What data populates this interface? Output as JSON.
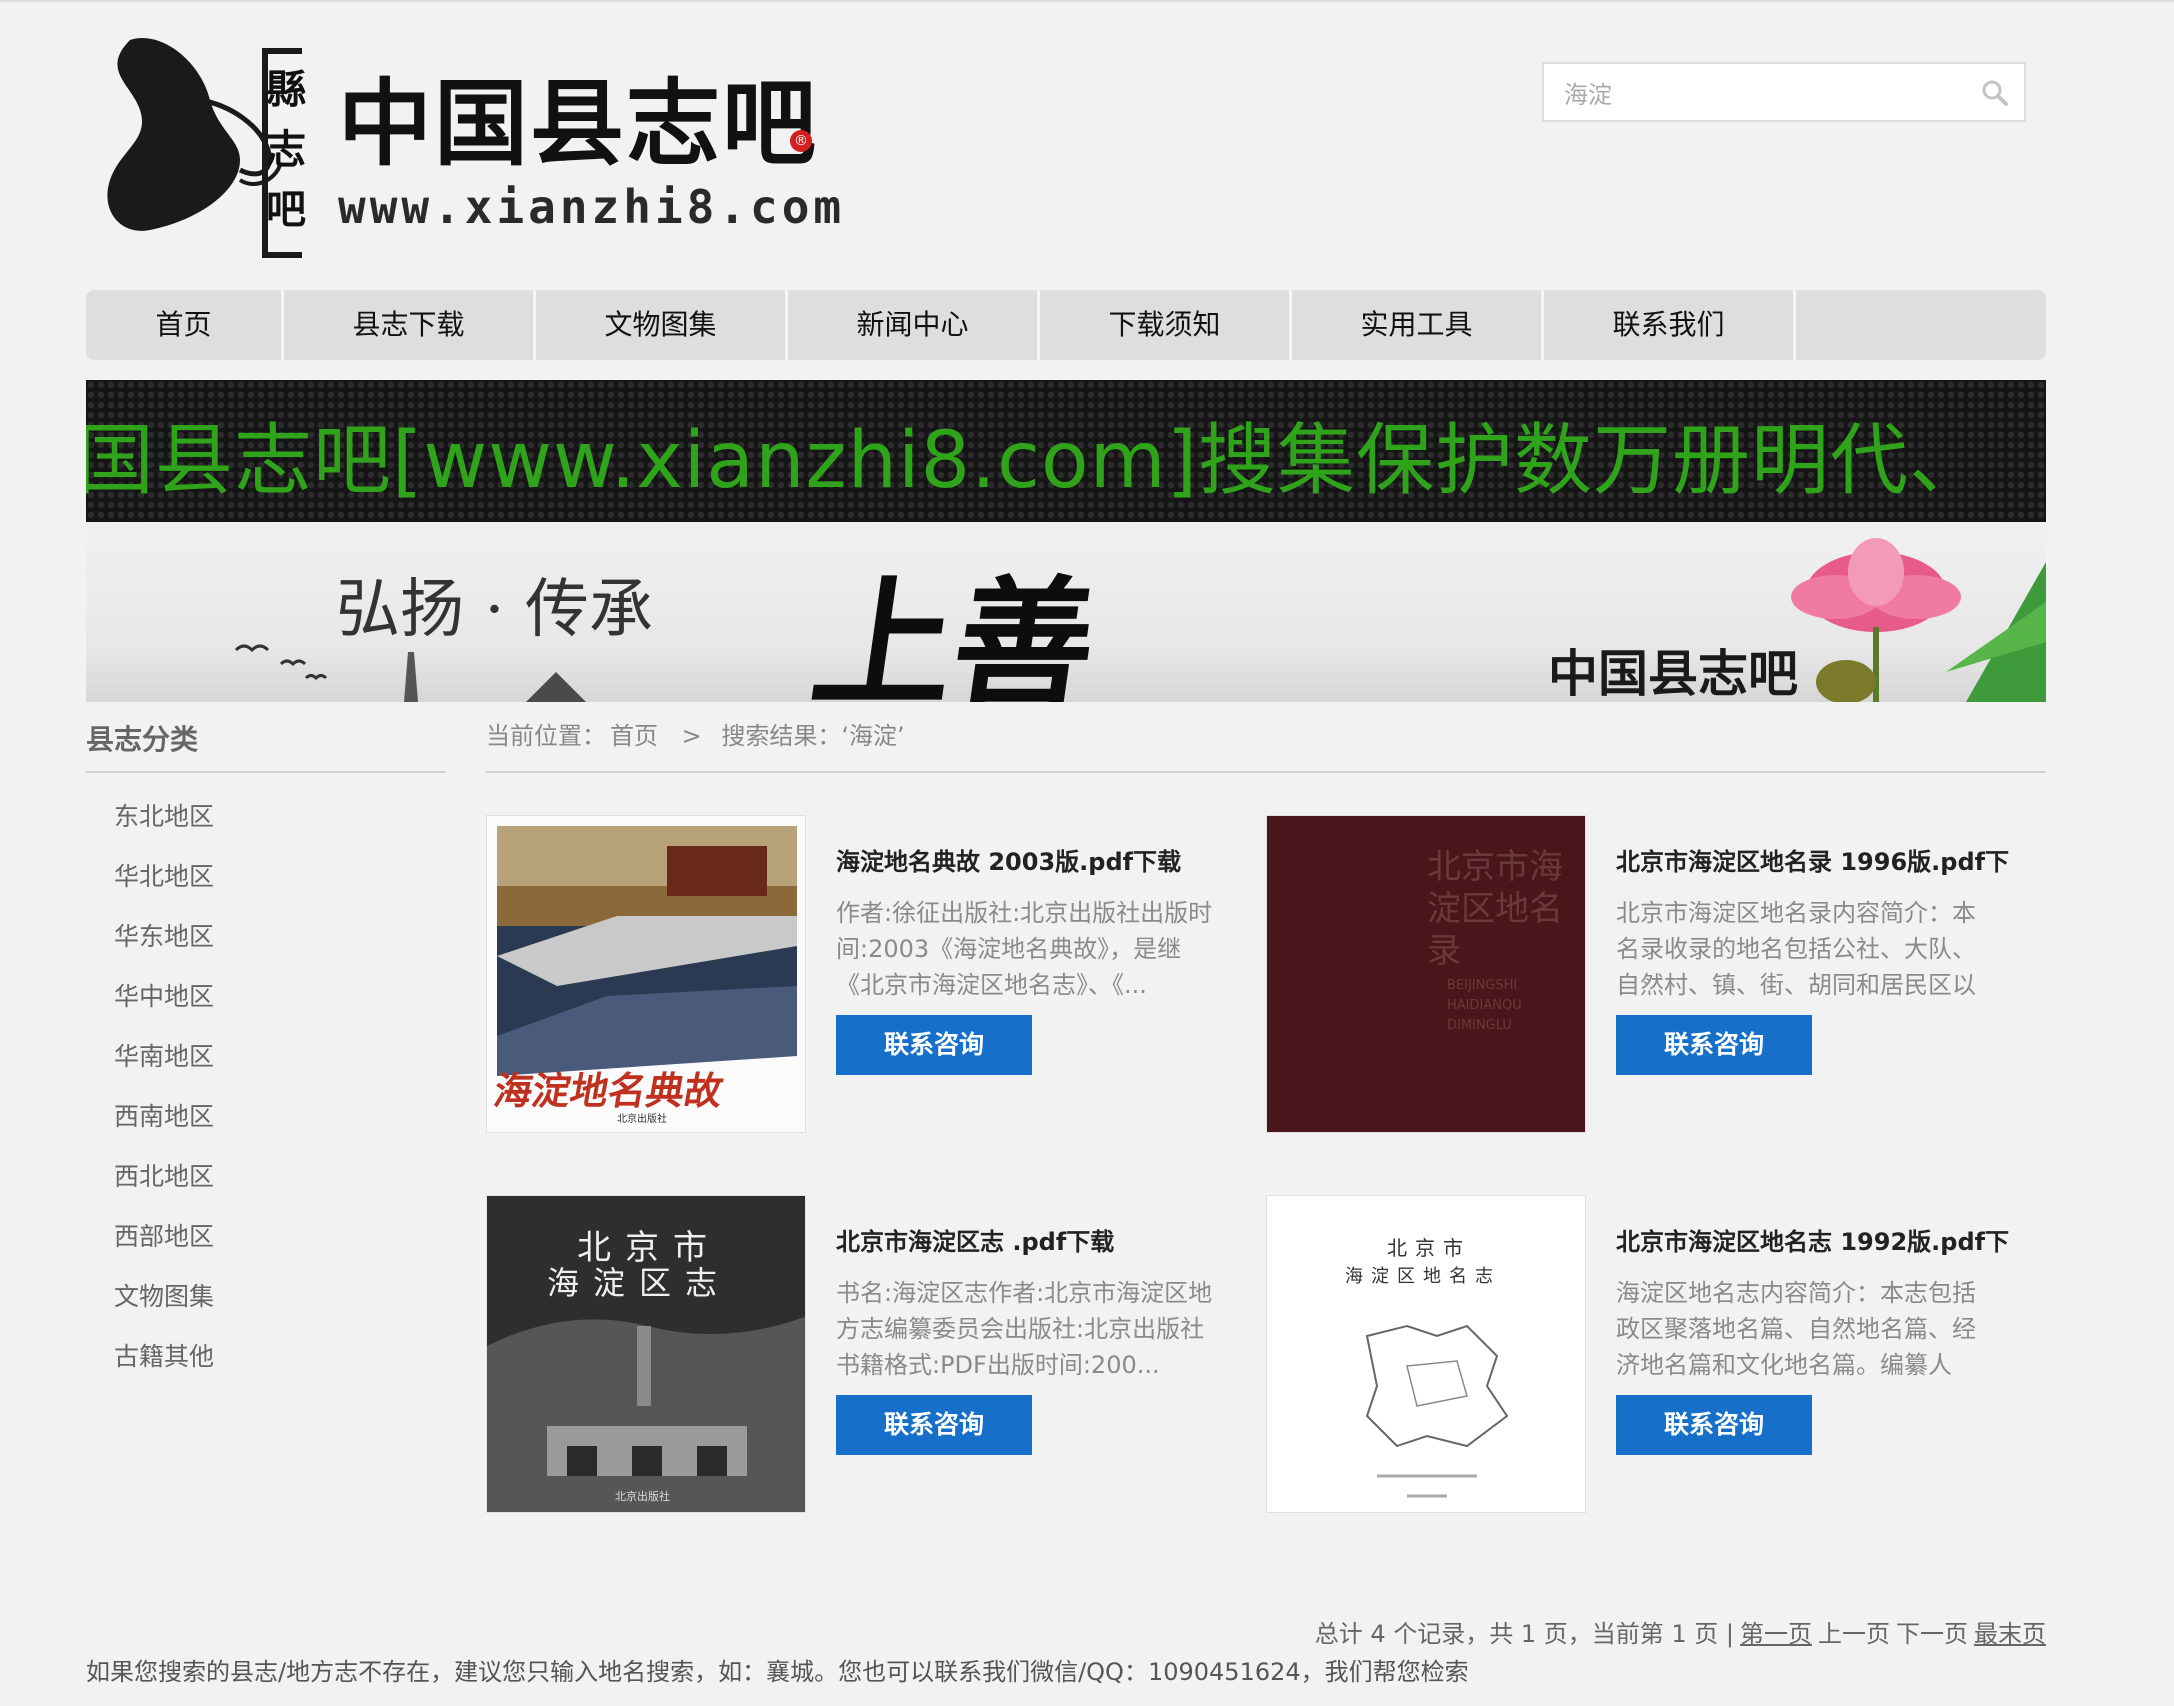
{
  "header": {
    "logo_vertical": "縣志吧",
    "logo_title": "中国县志吧",
    "logo_reg_mark": "®",
    "logo_url": "www.xianzhi8.com",
    "search": {
      "value": "海淀"
    }
  },
  "nav": {
    "items": [
      "首页",
      "县志下载",
      "文物图集",
      "新闻中心",
      "下载须知",
      "实用工具",
      "联系我们"
    ]
  },
  "marquee": {
    "text": "国县志吧[www.xianzhi8.com]搜集保护数万册明代、"
  },
  "banner": {
    "slogan": "弘扬 · 传承",
    "big_text": "上善",
    "brand": "中国县志吧"
  },
  "sidebar": {
    "title": "县志分类",
    "items": [
      "东北地区",
      "华北地区",
      "华东地区",
      "华中地区",
      "华南地区",
      "西南地区",
      "西北地区",
      "西部地区",
      "文物图集",
      "古籍其他"
    ]
  },
  "breadcrumb": {
    "label": "当前位置：",
    "home": "首页",
    "separator": ">",
    "current": "搜索结果：‘海淀’"
  },
  "results": [
    {
      "title": "海淀地名典故 2003版.pdf下载",
      "desc": "作者:徐征出版社:北京出版社出版时间:2003《海淀地名典故》，是继《北京市海淀区地名志》、《...",
      "button": "联系咨询",
      "cover_text": "海淀地名典故",
      "cover_publisher": "北京出版社"
    },
    {
      "title": "北京市海淀区地名录 1996版.pdf下",
      "desc": "北京市海淀区地名录内容简介：本名录收录的地名包括公社、大队、自然村、镇、街、胡同和居民区以及自...",
      "button": "联系咨询",
      "cover_text": "北京市海淀区地名录",
      "cover_pinyin": "BEIJINGSHI HAIDIANQU DIMINGLU"
    },
    {
      "title": "北京市海淀区志 .pdf下载",
      "desc": "书名:海淀区志作者:北京市海淀区地方志编纂委员会出版社:北京出版社书籍格式:PDF出版时间:200...",
      "button": "联系咨询",
      "cover_line1": "北京市",
      "cover_line2": "海淀区志",
      "cover_publisher": "北京出版社"
    },
    {
      "title": "北京市海淀区地名志 1992版.pdf下",
      "desc": "海淀区地名志内容简介：本志包括政区聚落地名篇、自然地名篇、经济地名篇和文化地名篇。编纂人员：田...",
      "button": "联系咨询",
      "cover_line1": "北京市",
      "cover_line2": "海淀区地名志"
    }
  ],
  "pager": {
    "summary": "总计 4 个记录，共 1 页，当前第 1 页 |",
    "first": "第一页",
    "prev": "上一页",
    "next": "下一页",
    "last": "最末页"
  },
  "footer_note": "如果您搜索的县志/地方志不存在，建议您只输入地名搜索，如：襄城。您也可以联系我们微信/QQ：1090451624，我们帮您检索",
  "colors": {
    "accent_button": "#1670c9",
    "marquee_text": "#2fa31a",
    "page_bg": "#f2f2f2"
  }
}
